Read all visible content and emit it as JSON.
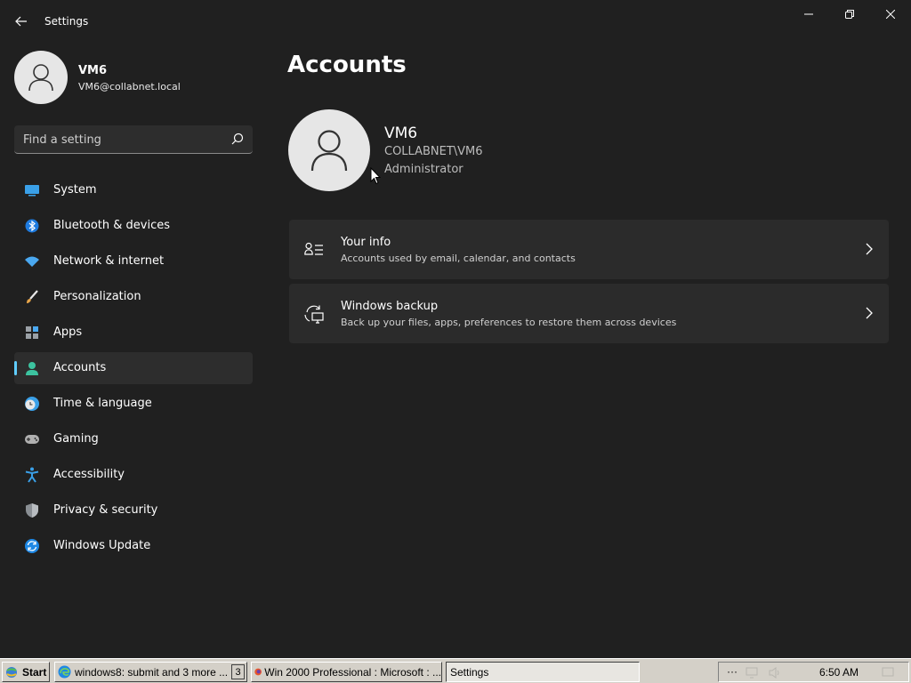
{
  "window": {
    "title": "Settings"
  },
  "profile": {
    "name": "VM6",
    "email": "VM6@collabnet.local"
  },
  "search": {
    "placeholder": "Find a setting"
  },
  "nav": {
    "items": [
      {
        "label": "System",
        "icon": "system-icon"
      },
      {
        "label": "Bluetooth & devices",
        "icon": "bluetooth-icon"
      },
      {
        "label": "Network & internet",
        "icon": "wifi-icon"
      },
      {
        "label": "Personalization",
        "icon": "brush-icon"
      },
      {
        "label": "Apps",
        "icon": "apps-icon"
      },
      {
        "label": "Accounts",
        "icon": "accounts-icon",
        "active": true
      },
      {
        "label": "Time & language",
        "icon": "clock-globe-icon"
      },
      {
        "label": "Gaming",
        "icon": "gamepad-icon"
      },
      {
        "label": "Accessibility",
        "icon": "accessibility-icon"
      },
      {
        "label": "Privacy & security",
        "icon": "shield-icon"
      },
      {
        "label": "Windows Update",
        "icon": "update-icon"
      }
    ]
  },
  "main": {
    "title": "Accounts",
    "account": {
      "name": "VM6",
      "domain": "COLLABNET\\VM6",
      "role": "Administrator"
    },
    "cards": [
      {
        "title": "Your info",
        "description": "Accounts used by email, calendar, and contacts",
        "icon": "contact-card-icon"
      },
      {
        "title": "Windows backup",
        "description": "Back up your files, apps, preferences to restore them across devices",
        "icon": "backup-sync-icon"
      }
    ]
  },
  "taskbar": {
    "start_label": "Start",
    "edge_label": "windows8: submit and 3 more ...",
    "edge_count": "3",
    "firefox_label": "Win 2000 Professional : Microsoft : ...",
    "settings_label": "Settings",
    "tray_more": "···",
    "time": "6:50 AM"
  },
  "colors": {
    "background": "#202020",
    "card": "#2b2b2b",
    "accent": "#60cdff",
    "taskbar": "#d4d0c8"
  }
}
